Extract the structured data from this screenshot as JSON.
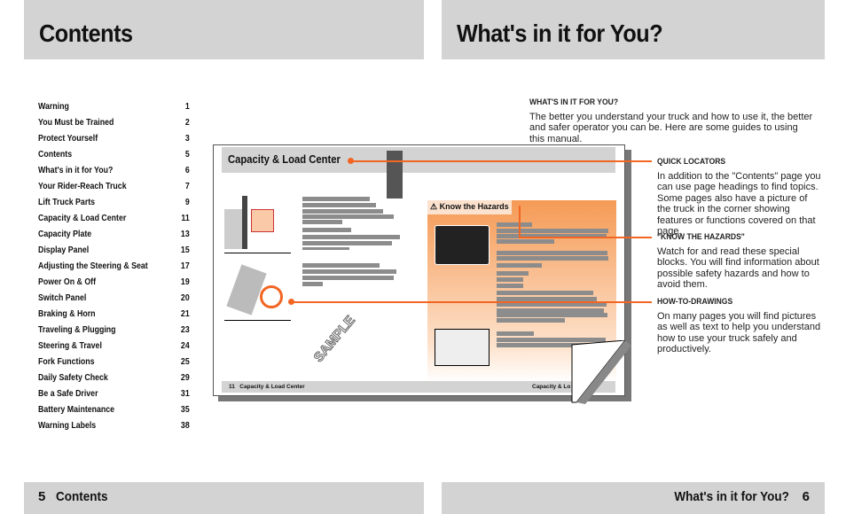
{
  "left_page": {
    "title": "Contents",
    "toc": [
      {
        "label": "Warning",
        "page": "1"
      },
      {
        "label": "You Must be Trained",
        "page": "2"
      },
      {
        "label": "Protect Yourself",
        "page": "3"
      },
      {
        "label": "Contents",
        "page": "5"
      },
      {
        "label": "What's in it for You?",
        "page": "6"
      },
      {
        "label": "Your Rider-Reach Truck",
        "page": "7"
      },
      {
        "label": "Lift Truck Parts",
        "page": "9"
      },
      {
        "label": "Capacity & Load Center",
        "page": "11"
      },
      {
        "label": "Capacity Plate",
        "page": "13"
      },
      {
        "label": "Display Panel",
        "page": "15"
      },
      {
        "label": "Adjusting the Steering & Seat",
        "page": "17"
      },
      {
        "label": "Power On & Off",
        "page": "19"
      },
      {
        "label": "Switch Panel",
        "page": "20"
      },
      {
        "label": "Braking & Horn",
        "page": "21"
      },
      {
        "label": "Traveling & Plugging",
        "page": "23"
      },
      {
        "label": "Steering & Travel",
        "page": "24"
      },
      {
        "label": "Fork Functions",
        "page": "25"
      },
      {
        "label": "Daily Safety Check",
        "page": "29"
      },
      {
        "label": "Be a Safe Driver",
        "page": "31"
      },
      {
        "label": "Battery Maintenance",
        "page": "35"
      },
      {
        "label": "Warning Labels",
        "page": "38"
      }
    ],
    "footer_number": "5",
    "footer_title": "Contents"
  },
  "right_page": {
    "title": "What's in it for You?",
    "intro_heading": "WHAT'S IN IT FOR YOU?",
    "intro_text": "The better you understand your truck and how to use it, the better and safer operator you can be. Here are some guides to using this manual.",
    "callouts": [
      {
        "heading": "QUICK LOCATORS",
        "text": "In addition to the \"Contents\" page you can use page headings to find topics. Some pages also have a picture of the truck in the corner showing features or functions covered on that page."
      },
      {
        "heading": "\"KNOW THE HAZARDS\"",
        "text": "Watch for and read these special blocks. You will find information about possible safety hazards and how to avoid them."
      },
      {
        "heading": "HOW-TO-DRAWINGS",
        "text": "On many pages you will find pictures as well as text to help you understand how to use your truck safely and productively."
      }
    ],
    "footer_number": "6",
    "footer_title": "What's in it for You?"
  },
  "sample_page": {
    "heading": "Capacity & Load Center",
    "hazard_title": "Know the Hazards",
    "watermark": "SAMPLE",
    "footer_left_number": "11",
    "footer_left_title": "Capacity & Load Center",
    "footer_right_title": "Capacity & Lo"
  },
  "colors": {
    "accent": "#f26522",
    "header_gray": "#d3d3d3"
  }
}
